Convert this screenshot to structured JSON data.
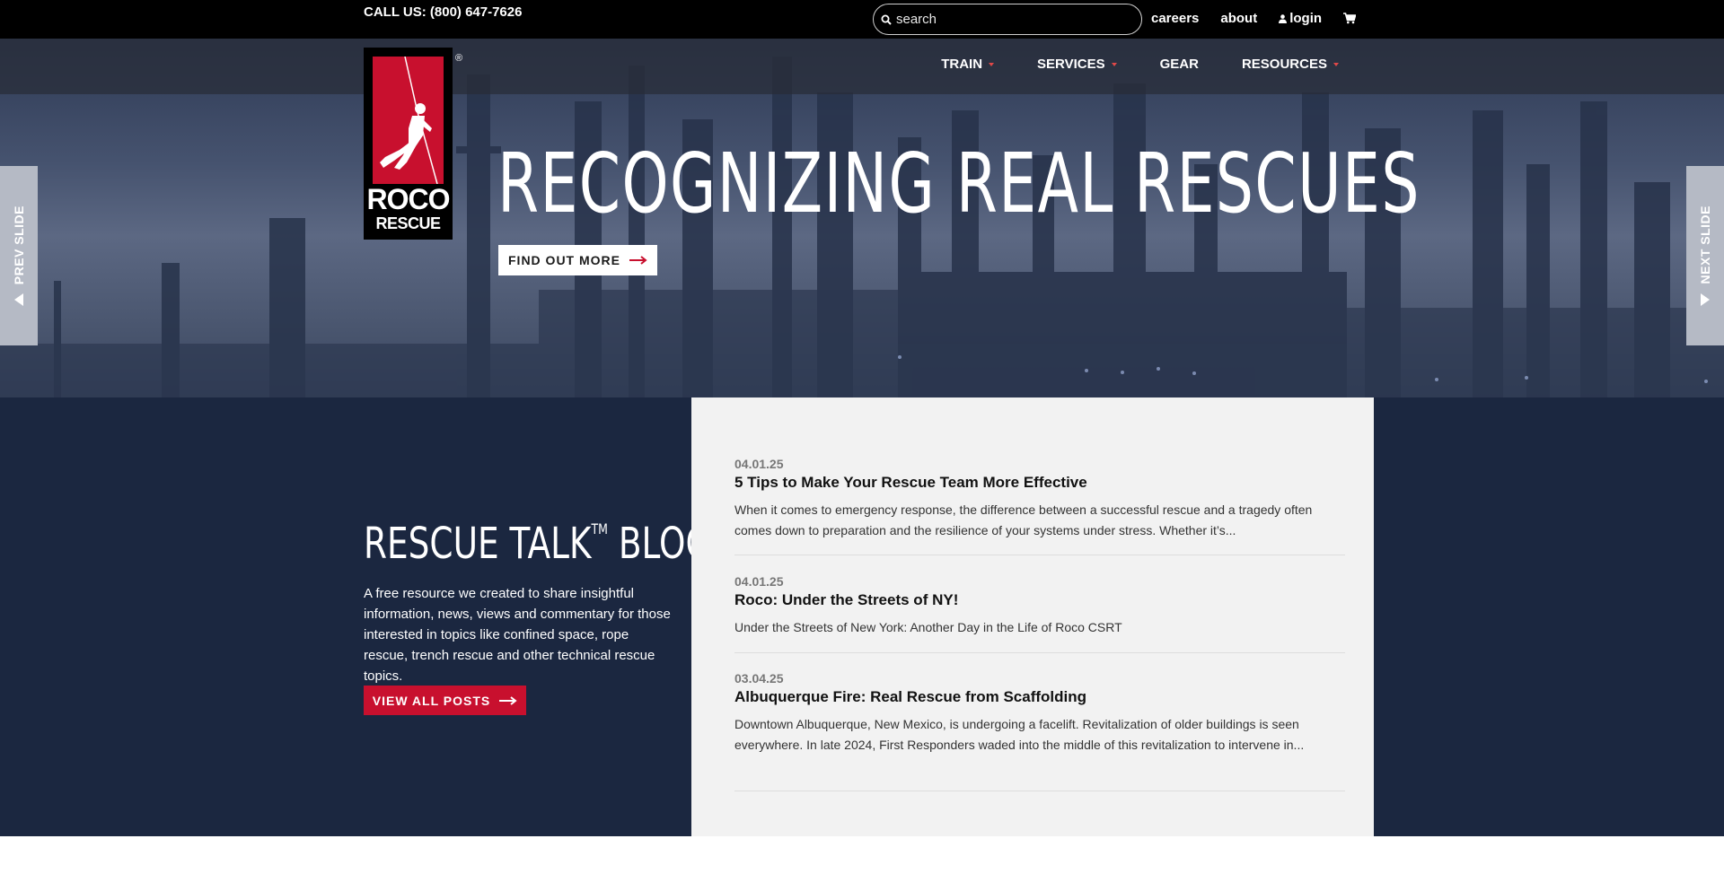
{
  "topbar": {
    "call": "CALL US: (800) 647-7626",
    "search_placeholder": "search",
    "links": {
      "careers": "careers",
      "about": "about",
      "login": "login"
    }
  },
  "nav": {
    "items": [
      {
        "label": "TRAIN"
      },
      {
        "label": "SERVICES"
      },
      {
        "label": "GEAR"
      },
      {
        "label": "RESOURCES"
      }
    ]
  },
  "logo": {
    "line1": "ROCO",
    "line2": "RESCUE",
    "registered": "®"
  },
  "hero": {
    "title": "RECOGNIZING REAL RESCUES",
    "cta": "FIND OUT MORE",
    "prev": "PREV SLIDE",
    "next": "NEXT SLIDE"
  },
  "blog": {
    "title": "RESCUE TALK",
    "title_tm": "TM",
    "title_suffix": "BLOG",
    "description": "A free resource we created to share insightful information, news, views and commentary for those interested in topics like confined space, rope rescue, trench rescue and other technical rescue topics.",
    "cta": "VIEW ALL POSTS",
    "posts": [
      {
        "date": "04.01.25",
        "title": "5 Tips to Make Your Rescue Team More Effective",
        "excerpt": "When it comes to emergency response, the difference between a successful rescue and a tragedy often comes down to preparation and the resilience of your systems under stress. Whether it’s..."
      },
      {
        "date": "04.01.25",
        "title": "Roco: Under the Streets of NY!",
        "excerpt": "Under the Streets of New York: Another Day in the Life of Roco CSRT"
      },
      {
        "date": "03.04.25",
        "title": "Albuquerque Fire: Real Rescue from Scaffolding",
        "excerpt": "Downtown Albuquerque, New Mexico, is undergoing a facelift. Revitalization of older buildings is seen everywhere. In late 2024, First Responders waded into the middle of this revitalization to intervene in..."
      }
    ]
  },
  "colors": {
    "brand_red": "#c8102e",
    "navy": "#1b2740",
    "black": "#000000",
    "caret_red": "#e04848"
  }
}
